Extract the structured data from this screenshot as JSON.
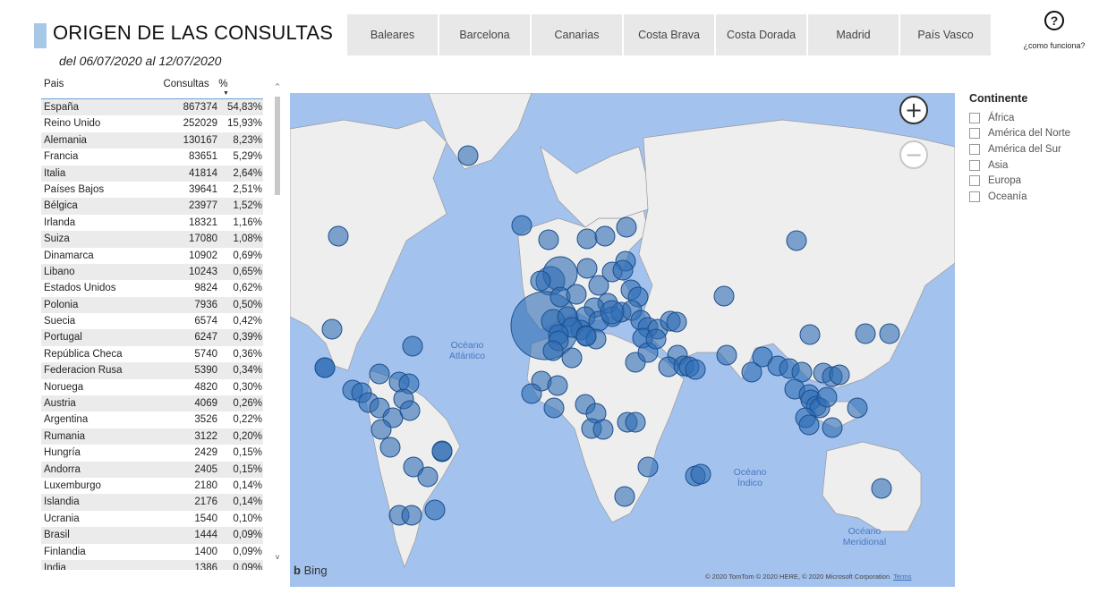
{
  "header": {
    "title": "ORIGEN DE LAS CONSULTAS",
    "subtitle": "del 06/07/2020 al 12/07/2020",
    "accent_color": "#a8c8e8"
  },
  "tabs": [
    "Baleares",
    "Barcelona",
    "Canarias",
    "Costa Brava",
    "Costa Dorada",
    "Madrid",
    "País Vasco"
  ],
  "help": {
    "icon": "question-circle-icon",
    "label": "¿como funciona?"
  },
  "table": {
    "headers": [
      "Pais",
      "Consultas",
      "%"
    ],
    "sort_column": "%",
    "rows": [
      [
        "España",
        "867374",
        "54,83%"
      ],
      [
        "Reino Unido",
        "252029",
        "15,93%"
      ],
      [
        "Alemania",
        "130167",
        "8,23%"
      ],
      [
        "Francia",
        "83651",
        "5,29%"
      ],
      [
        "Italia",
        "41814",
        "2,64%"
      ],
      [
        "Países Bajos",
        "39641",
        "2,51%"
      ],
      [
        "Bélgica",
        "23977",
        "1,52%"
      ],
      [
        "Irlanda",
        "18321",
        "1,16%"
      ],
      [
        "Suiza",
        "17080",
        "1,08%"
      ],
      [
        "Dinamarca",
        "10902",
        "0,69%"
      ],
      [
        "Libano",
        "10243",
        "0,65%"
      ],
      [
        "Estados Unidos",
        "9824",
        "0,62%"
      ],
      [
        "Polonia",
        "7936",
        "0,50%"
      ],
      [
        "Suecia",
        "6574",
        "0,42%"
      ],
      [
        "Portugal",
        "6247",
        "0,39%"
      ],
      [
        "República Checa",
        "5740",
        "0,36%"
      ],
      [
        "Federacion Rusa",
        "5390",
        "0,34%"
      ],
      [
        "Noruega",
        "4820",
        "0,30%"
      ],
      [
        "Austria",
        "4069",
        "0,26%"
      ],
      [
        "Argentina",
        "3526",
        "0,22%"
      ],
      [
        "Rumania",
        "3122",
        "0,20%"
      ],
      [
        "Hungría",
        "2429",
        "0,15%"
      ],
      [
        "Andorra",
        "2405",
        "0,15%"
      ],
      [
        "Luxemburgo",
        "2180",
        "0,14%"
      ],
      [
        "Islandia",
        "2176",
        "0,14%"
      ],
      [
        "Ucrania",
        "1540",
        "0,10%"
      ],
      [
        "Brasil",
        "1444",
        "0,09%"
      ],
      [
        "Finlandia",
        "1400",
        "0,09%"
      ],
      [
        "India",
        "1386",
        "0,09%"
      ]
    ]
  },
  "map": {
    "ocean_labels": [
      "Océano Atlántico",
      "Océano Índico",
      "Océano Meridional"
    ],
    "provider": "Bing",
    "copyright": "© 2020 TomTom © 2020 HERE, © 2020 Microsoft Corporation",
    "terms": "Terms",
    "zoom_in": "+",
    "zoom_out": "−",
    "bubble_color": "#2e6db4",
    "water_color": "#a3c2ee",
    "land_color": "#eeeeee"
  },
  "legend": {
    "title": "Continente",
    "items": [
      "África",
      "América del Norte",
      "América del Sur",
      "Asia",
      "Europa",
      "Oceanía"
    ]
  }
}
